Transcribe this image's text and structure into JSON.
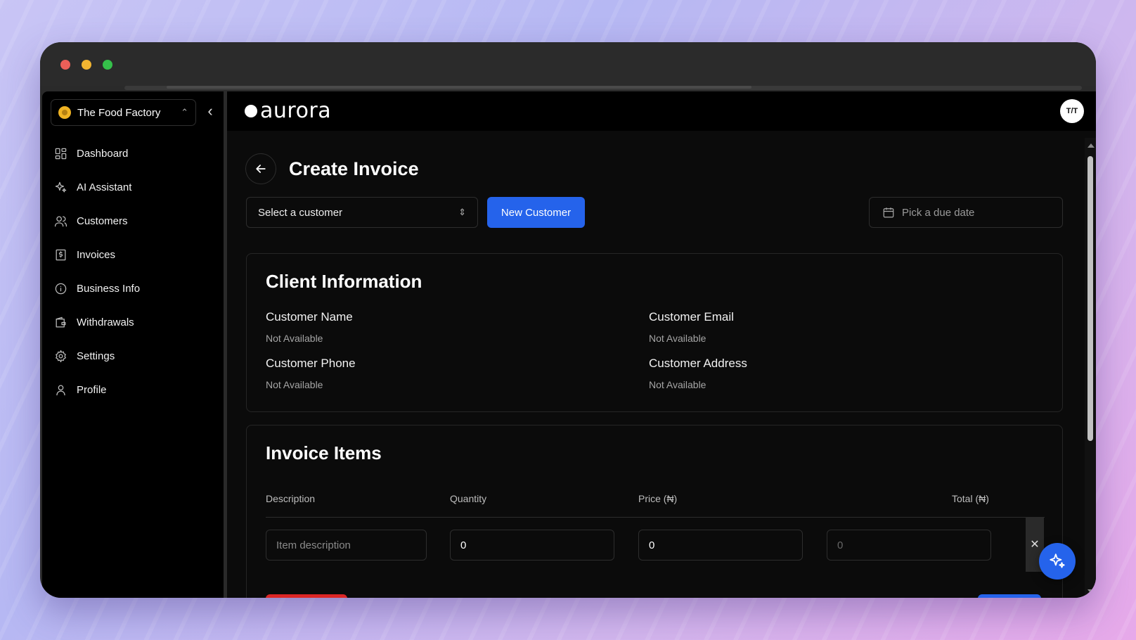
{
  "org": {
    "name": "The Food Factory",
    "icon": "company-logo-icon"
  },
  "sidebar": {
    "items": [
      {
        "label": "Dashboard",
        "icon": "dashboard-icon"
      },
      {
        "label": "AI Assistant",
        "icon": "sparkles-icon"
      },
      {
        "label": "Customers",
        "icon": "users-icon"
      },
      {
        "label": "Invoices",
        "icon": "invoice-icon"
      },
      {
        "label": "Business Info",
        "icon": "info-icon"
      },
      {
        "label": "Withdrawals",
        "icon": "wallet-icon"
      },
      {
        "label": "Settings",
        "icon": "gear-icon"
      },
      {
        "label": "Profile",
        "icon": "user-icon"
      }
    ]
  },
  "header": {
    "brand": "aurora",
    "avatar_text": "T/T"
  },
  "page": {
    "title": "Create Invoice"
  },
  "toolbar": {
    "customer_select": "Select a customer",
    "new_customer": "New Customer",
    "due_date_placeholder": "Pick a due date"
  },
  "client_info": {
    "title": "Client Information",
    "fields": [
      {
        "label": "Customer Name",
        "value": "Not Available"
      },
      {
        "label": "Customer Email",
        "value": "Not Available"
      },
      {
        "label": "Customer Phone",
        "value": "Not Available"
      },
      {
        "label": "Customer Address",
        "value": "Not Available"
      }
    ]
  },
  "invoice_items": {
    "title": "Invoice Items",
    "columns": [
      "Description",
      "Quantity",
      "Price (₦)",
      "Total (₦)"
    ],
    "row": {
      "description_placeholder": "Item description",
      "quantity": "0",
      "price": "0",
      "total": "0",
      "remove": "✕"
    }
  },
  "colors": {
    "accent": "#2563eb",
    "danger": "#dc2626",
    "background": "#0b0b0b"
  }
}
